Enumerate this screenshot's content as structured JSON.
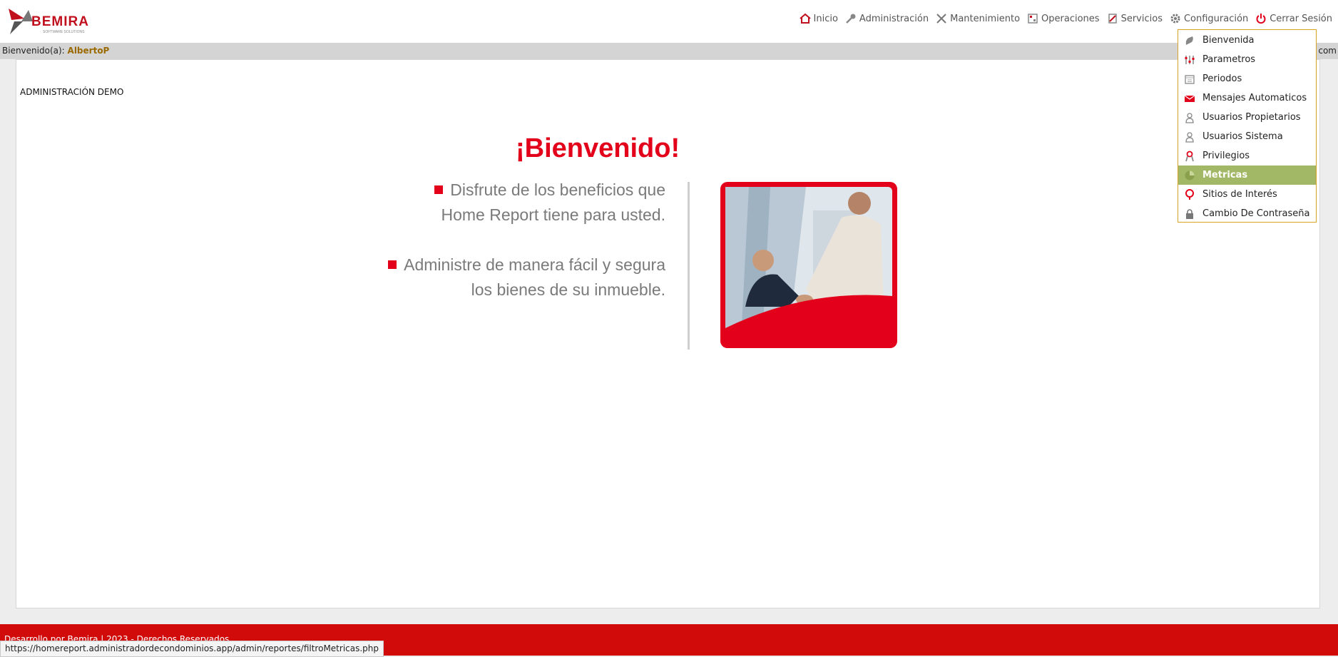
{
  "header": {
    "logo_text": "BEMIRA",
    "logo_sub": "SOFTWARE SOLUTIONS",
    "nav": [
      {
        "label": "Inicio",
        "icon": "home-icon"
      },
      {
        "label": "Administración",
        "icon": "key-icon"
      },
      {
        "label": "Mantenimiento",
        "icon": "tools-icon"
      },
      {
        "label": "Operaciones",
        "icon": "calculator-icon"
      },
      {
        "label": "Servicios",
        "icon": "services-icon"
      },
      {
        "label": "Configuración",
        "icon": "gear-icon"
      },
      {
        "label": "Cerrar Sesión",
        "icon": "power-icon"
      }
    ]
  },
  "welcome_bar": {
    "prefix": "Bienvenido(a):",
    "user": "AlbertoP",
    "right_text": "com"
  },
  "main": {
    "org_name": "ADMINISTRACIÓN DEMO",
    "title": "¡Bienvenido!",
    "bullets": [
      {
        "line1": "Disfrute de los beneficios que",
        "line2": "Home Report tiene para usted."
      },
      {
        "line1": "Administre de manera fácil y segura",
        "line2": "los bienes de su inmueble."
      }
    ]
  },
  "dropdown": {
    "items": [
      {
        "label": "Bienvenida",
        "icon": "hand-icon",
        "active": false
      },
      {
        "label": "Parametros",
        "icon": "sliders-icon",
        "active": false
      },
      {
        "label": "Periodos",
        "icon": "calendar-icon",
        "active": false
      },
      {
        "label": "Mensajes Automaticos",
        "icon": "mail-icon",
        "active": false
      },
      {
        "label": "Usuarios Propietarios",
        "icon": "user-icon",
        "active": false
      },
      {
        "label": "Usuarios Sistema",
        "icon": "user-icon",
        "active": false
      },
      {
        "label": "Privilegios",
        "icon": "ribbon-icon",
        "active": false
      },
      {
        "label": "Metricas",
        "icon": "chart-icon",
        "active": true
      },
      {
        "label": "Sitios de Interés",
        "icon": "pin-icon",
        "active": false
      },
      {
        "label": "Cambio De Contraseña",
        "icon": "lock-icon",
        "active": false
      }
    ]
  },
  "footer": {
    "text": "Desarrollo por Bemira | 2023 - Derechos Reservados",
    "status_url": "https://homereport.administradordecondominios.app/admin/reportes/filtroMetricas.php"
  },
  "colors": {
    "brand_red": "#e3001b",
    "active_menu": "#a3b867",
    "footer_red": "#d10a0a"
  }
}
